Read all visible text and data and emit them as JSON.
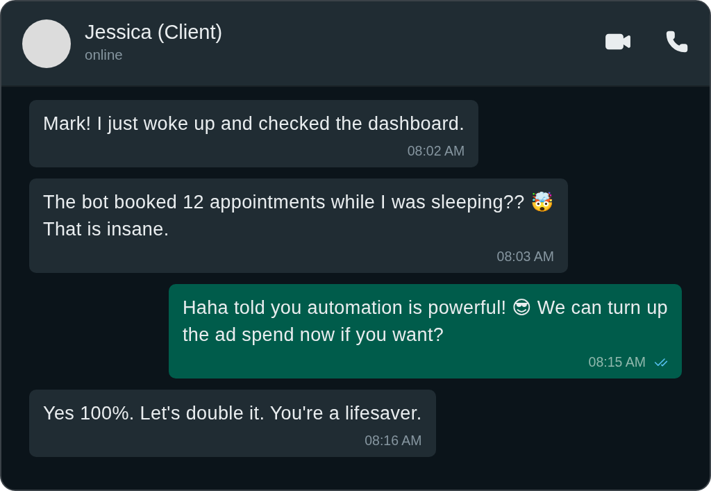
{
  "contact": {
    "name": "Jessica (Client)",
    "status": "online"
  },
  "messages": [
    {
      "kind": "incoming",
      "lines": [
        "Mark! I just woke up and checked the dashboard."
      ],
      "time": "08:02 AM",
      "read": false
    },
    {
      "kind": "incoming",
      "lines": [
        "The bot booked 12 appointments while I was sleeping?? 🤯",
        "That is insane."
      ],
      "time": "08:03 AM",
      "read": false
    },
    {
      "kind": "outgoing",
      "lines": [
        "Haha told you automation is powerful! 😎 We can turn up",
        "the ad spend now if you want?"
      ],
      "time": "08:15 AM",
      "read": true
    },
    {
      "kind": "incoming",
      "lines": [
        "Yes 100%. Let's double it. You're a lifesaver."
      ],
      "time": "08:16 AM",
      "read": false
    }
  ]
}
